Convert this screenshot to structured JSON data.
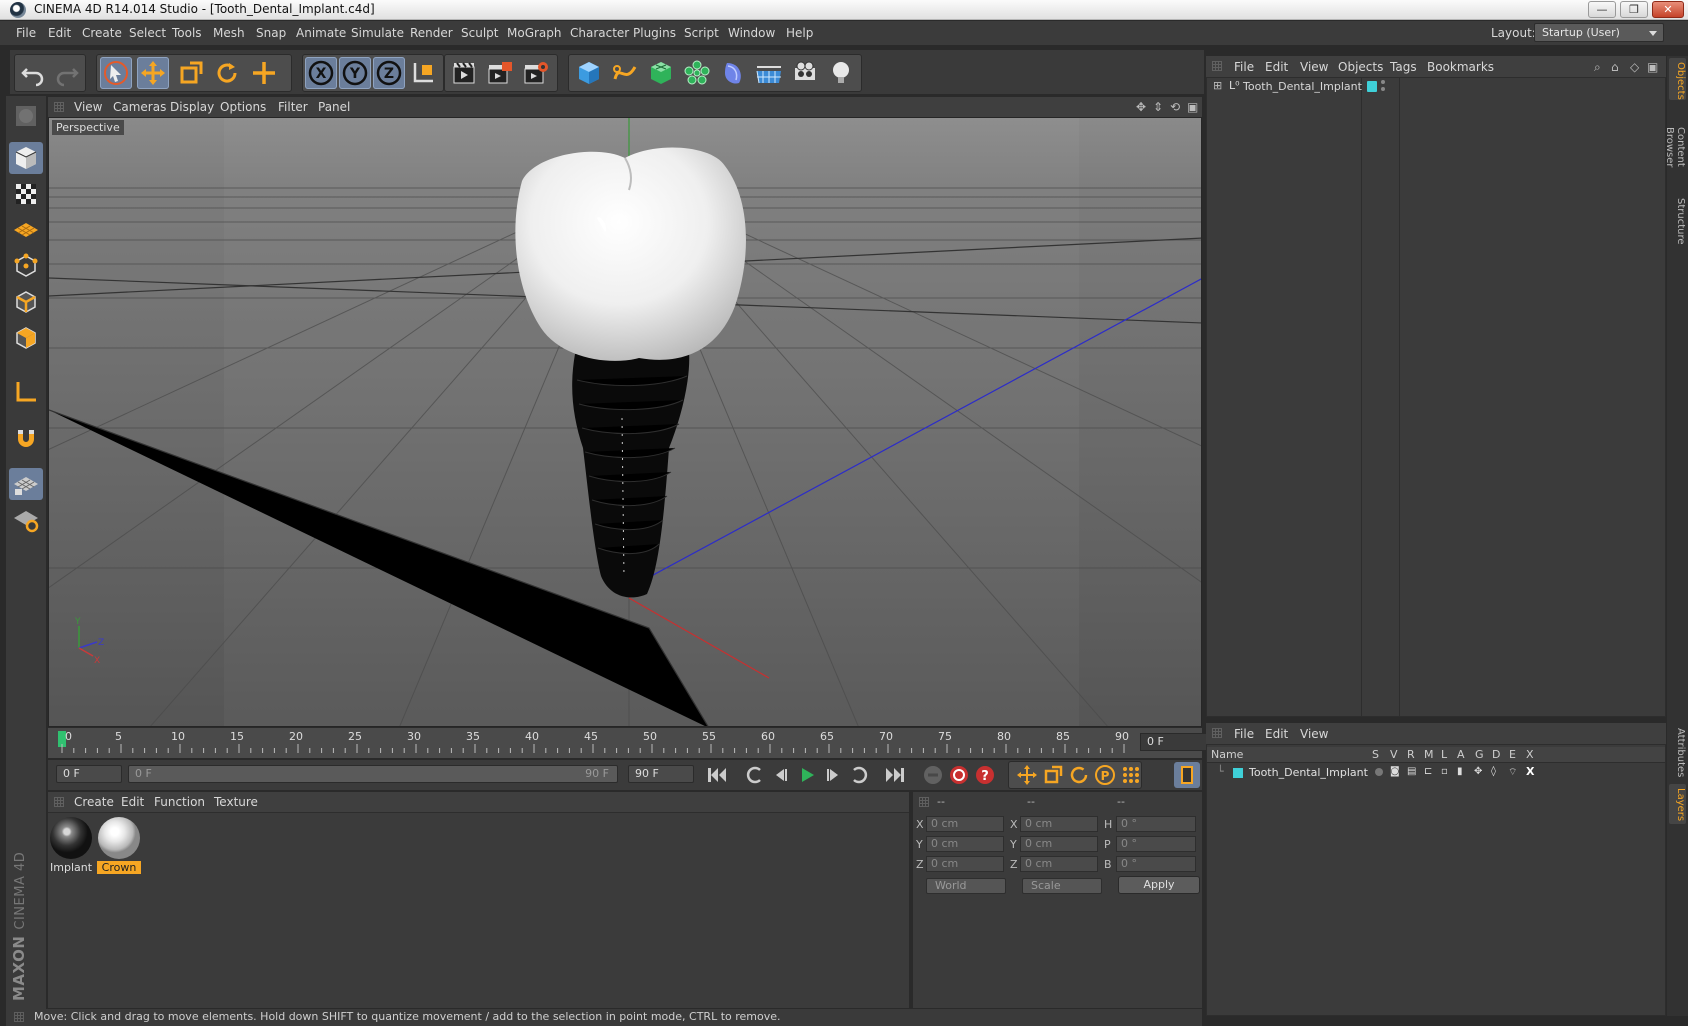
{
  "window": {
    "title": "CINEMA 4D R14.014 Studio - [Tooth_Dental_Implant.c4d]",
    "btn_min": "—",
    "btn_max": "❐",
    "btn_close": "✕"
  },
  "menu": {
    "items": [
      "File",
      "Edit",
      "Create",
      "Select",
      "Tools",
      "Mesh",
      "Snap",
      "Animate",
      "Simulate",
      "Render",
      "Sculpt",
      "MoGraph",
      "Character",
      "Plugins",
      "Script",
      "Window",
      "Help"
    ],
    "layout_label": "Layout:",
    "layout_value": "Startup (User)"
  },
  "toolbar": {
    "icons": [
      "undo-icon",
      "redo-icon",
      "live-selection-icon",
      "move-icon",
      "scale-icon",
      "rotate-icon",
      "add-object-icon",
      "x-axis-icon",
      "y-axis-icon",
      "z-axis-icon",
      "coordinate-system-icon",
      "render-view-icon",
      "render-picture-viewer-icon",
      "render-settings-icon",
      "cube-icon",
      "spline-pen-icon",
      "subdivision-surface-icon",
      "cloner-icon",
      "deformer-icon",
      "floor-icon",
      "camera-icon",
      "light-icon"
    ],
    "axis_x": "X",
    "axis_y": "Y",
    "axis_z": "Z"
  },
  "viewport": {
    "menu": [
      "View",
      "Cameras",
      "Display",
      "Options",
      "Filter",
      "Panel"
    ],
    "label": "Perspective",
    "axis_y": "Y",
    "axis_z": "Z",
    "axis_x": "X"
  },
  "timeline": {
    "ticks": [
      "0",
      "5",
      "10",
      "15",
      "20",
      "25",
      "30",
      "35",
      "40",
      "45",
      "50",
      "55",
      "60",
      "65",
      "70",
      "75",
      "80",
      "85",
      "90"
    ],
    "current_frame": "0 F",
    "start_field": "0 F",
    "range_start": "0 F",
    "range_end": "90 F",
    "end_field": "90 F"
  },
  "materials": {
    "menu": [
      "Create",
      "Edit",
      "Function",
      "Texture"
    ],
    "items": [
      {
        "name": "Implant",
        "selected": false
      },
      {
        "name": "Crown",
        "selected": true
      }
    ]
  },
  "coordinates": {
    "headers": [
      "--",
      "--",
      "--"
    ],
    "rows": [
      {
        "l1": "X",
        "v1": "0 cm",
        "l2": "X",
        "v2": "0 cm",
        "l3": "H",
        "v3": "0 °"
      },
      {
        "l1": "Y",
        "v1": "0 cm",
        "l2": "Y",
        "v2": "0 cm",
        "l3": "P",
        "v3": "0 °"
      },
      {
        "l1": "Z",
        "v1": "0 cm",
        "l2": "Z",
        "v2": "0 cm",
        "l3": "B",
        "v3": "0 °"
      }
    ],
    "space": "World",
    "mode": "Scale",
    "apply": "Apply"
  },
  "status": {
    "text": "Move: Click and drag to move elements. Hold down SHIFT to quantize movement / add to the selection in point mode, CTRL to remove."
  },
  "objects": {
    "menu": [
      "File",
      "Edit",
      "View",
      "Objects",
      "Tags",
      "Bookmarks"
    ],
    "items": [
      {
        "name": "Tooth_Dental_Implant",
        "layer_color": "#3fd0d8"
      }
    ]
  },
  "layers": {
    "menu": [
      "File",
      "Edit",
      "View"
    ],
    "columns": [
      "Name",
      "S",
      "V",
      "R",
      "M",
      "L",
      "A",
      "G",
      "D",
      "E",
      "X"
    ],
    "items": [
      {
        "name": "Tooth_Dental_Implant",
        "color": "#3fd0d8"
      }
    ]
  },
  "side_tabs": [
    "Objects",
    "Content Browser",
    "Structure",
    "Attributes",
    "Layers"
  ],
  "brand": {
    "maxon": "MAXON",
    "product": "CINEMA 4D"
  },
  "colors": {
    "accent": "#f6a623",
    "active_tool": "#6b7e9b",
    "layer": "#3fd0d8"
  }
}
